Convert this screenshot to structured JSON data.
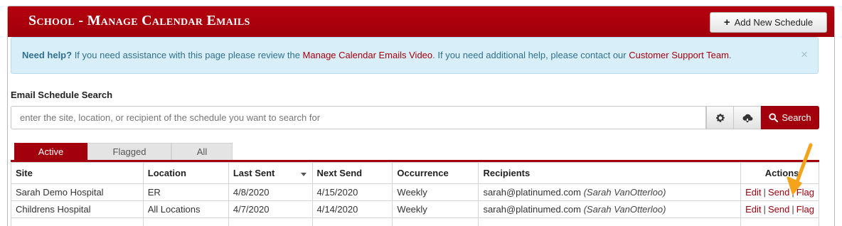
{
  "header": {
    "title": "School - Manage Calendar Emails",
    "add_button_label": "Add New Schedule",
    "add_icon": "plus-icon"
  },
  "alert": {
    "strong": "Need help?",
    "text1": " If you need assistance with this page please review the ",
    "link1": "Manage Calendar Emails Video",
    "text2": ". If you need additional help, please contact our ",
    "link2": "Customer Support Team",
    "text3": ".",
    "close": "×"
  },
  "search": {
    "label": "Email Schedule Search",
    "placeholder": "enter the site, location, or recipient of the schedule you want to search for",
    "settings_icon": "gear-icon",
    "download_icon": "cloud-download-icon",
    "button_label": "Search",
    "button_icon": "search-icon"
  },
  "tabs": [
    {
      "label": "Active",
      "active": true
    },
    {
      "label": "Flagged",
      "active": false
    },
    {
      "label": "All",
      "active": false
    }
  ],
  "table": {
    "columns": [
      "Site",
      "Location",
      "Last Sent",
      "Next Send",
      "Occurrence",
      "Recipients",
      "Actions"
    ],
    "sorted_column": "Last Sent",
    "rows": [
      {
        "site": "Sarah Demo Hospital",
        "location": "ER",
        "last_sent": "4/8/2020",
        "next_send": "4/15/2020",
        "occurrence": "Weekly",
        "email": "sarah@platinumed.com",
        "name": "(Sarah VanOtterloo)",
        "actions": [
          "Edit",
          "Send",
          "Flag"
        ]
      },
      {
        "site": "Childrens Hospital",
        "location": "All Locations",
        "last_sent": "4/7/2020",
        "next_send": "4/14/2020",
        "occurrence": "Weekly",
        "email": "sarah@platinumed.com",
        "name": "(Sarah VanOtterloo)",
        "actions": [
          "Edit",
          "Send",
          "Flag"
        ]
      }
    ]
  },
  "colors": {
    "brand_red": "#a3000d",
    "alert_bg": "#d8eef8",
    "arrow": "#f5a31a"
  }
}
